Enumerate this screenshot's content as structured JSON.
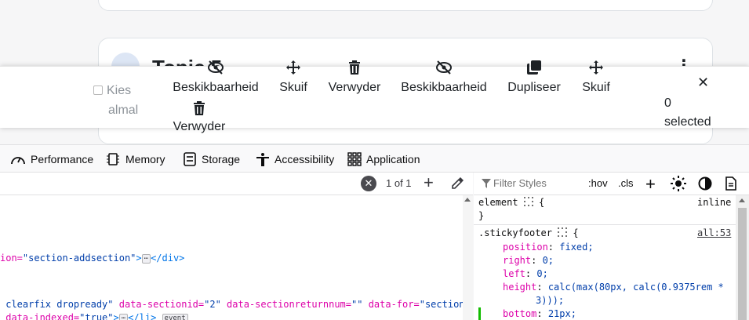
{
  "course": {
    "topic_title": "Topic 5"
  },
  "sticky_footer": {
    "select_all_line1": "Kies",
    "select_all_line2": "almal",
    "actions": {
      "availability_1": "Beskikbaarheid",
      "move_1": "Skuif",
      "delete_1": "Verwyder",
      "availability_2": "Beskikbaarheid",
      "duplicate": "Dupliseer",
      "move_2": "Skuif",
      "delete_2": "Verwyder"
    },
    "selected_count": "0",
    "selected_label": "selected"
  },
  "devtools": {
    "tabs": [
      "Performance",
      "Memory",
      "Storage",
      "Accessibility",
      "Application"
    ],
    "search": {
      "result_count": "1 of 1"
    },
    "markup_lines": {
      "line1_attr_tail": "ion=",
      "line1_val": "\"section-addsection\"",
      "line1_close": "</div>",
      "line2_class_tail": "clearfix dropready\"",
      "line2_attr1": "data-sectionid=",
      "line2_val1": "\"2\"",
      "line2_attr2": "data-sectionreturnnum=",
      "line2_val2": "\"\"",
      "line2_attr3": "data-for=",
      "line2_val3": "\"section\"",
      "line3_attr": "data-indexed=",
      "line3_val": "\"true\"",
      "line3_close": "</li>",
      "line3_badge": "event",
      "ellipsis": "⋯"
    },
    "styles": {
      "filter_placeholder": "Filter Styles",
      "hov": ":hov",
      "cls": ".cls",
      "element_selector": "element",
      "element_open": "{",
      "element_close": "}",
      "element_source": "inline",
      "rule_selector": ".stickyfooter",
      "rule_open": "{",
      "rule_source": "all:53",
      "props": [
        {
          "name": "position",
          "value": "fixed;"
        },
        {
          "name": "right",
          "value": "0;"
        },
        {
          "name": "left",
          "value": "0;"
        },
        {
          "name": "height",
          "value": "calc(max(80px, calc(0.9375rem *"
        },
        {
          "name": "",
          "value": "3)));"
        },
        {
          "name": "bottom",
          "value": "21px;"
        }
      ]
    }
  }
}
